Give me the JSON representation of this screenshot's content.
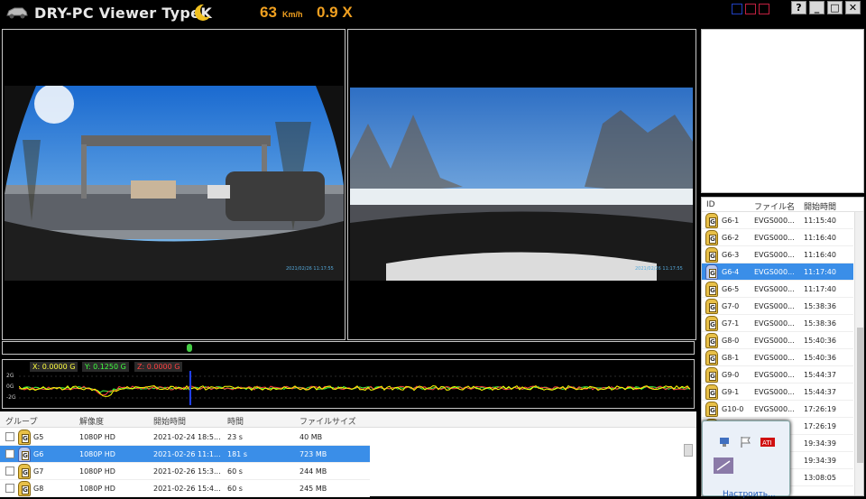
{
  "app": {
    "title": "DRY-PC Viewer TypeK",
    "speed_value": "63",
    "speed_unit": "Km/h",
    "gforce_value": "0.9 X"
  },
  "window_buttons": [
    "?",
    "_",
    "□",
    "✕"
  ],
  "cameras": {
    "front_timestamp": "2021/02/26 11:17:55",
    "rear_timestamp": "2021/02/26 11:17:55"
  },
  "graph": {
    "x_label": "X: 0.0000 G",
    "y_label": "Y: 0.1250 G",
    "z_label": "Z: 0.0000 G",
    "ticks": [
      "2G",
      "0G",
      "-2G"
    ],
    "colors": {
      "x": "#ffff00",
      "y": "#40ff40",
      "z": "#ff4040"
    }
  },
  "file_list": {
    "headers": {
      "id": "ID",
      "file": "ファイル名",
      "start": "開始時間"
    },
    "rows": [
      {
        "id": "G6-1",
        "file": "EVGS000...",
        "start": "11:15:40",
        "selected": false
      },
      {
        "id": "G6-2",
        "file": "EVGS000...",
        "start": "11:16:40",
        "selected": false
      },
      {
        "id": "G6-3",
        "file": "EVGS000...",
        "start": "11:16:40",
        "selected": false
      },
      {
        "id": "G6-4",
        "file": "EVGS000...",
        "start": "11:17:40",
        "selected": true
      },
      {
        "id": "G6-5",
        "file": "EVGS000...",
        "start": "11:17:40",
        "selected": false
      },
      {
        "id": "G7-0",
        "file": "EVGS000...",
        "start": "15:38:36",
        "selected": false
      },
      {
        "id": "G7-1",
        "file": "EVGS000...",
        "start": "15:38:36",
        "selected": false
      },
      {
        "id": "G8-0",
        "file": "EVGS000...",
        "start": "15:40:36",
        "selected": false
      },
      {
        "id": "G8-1",
        "file": "EVGS000...",
        "start": "15:40:36",
        "selected": false
      },
      {
        "id": "G9-0",
        "file": "EVGS000...",
        "start": "15:44:37",
        "selected": false
      },
      {
        "id": "G9-1",
        "file": "EVGS000...",
        "start": "15:44:37",
        "selected": false
      },
      {
        "id": "G10-0",
        "file": "EVGS000...",
        "start": "17:26:19",
        "selected": false
      },
      {
        "id": "",
        "file": "",
        "start": "17:26:19",
        "selected": false
      },
      {
        "id": "",
        "file": "",
        "start": "19:34:39",
        "selected": false
      },
      {
        "id": "",
        "file": "",
        "start": "19:34:39",
        "selected": false
      },
      {
        "id": "",
        "file": "",
        "start": "13:08:05",
        "selected": false
      }
    ]
  },
  "group_list": {
    "headers": {
      "group": "グループ",
      "resolution": "解像度",
      "start": "開始時間",
      "duration": "時間",
      "size": "ファイルサイズ"
    },
    "rows": [
      {
        "group": "G5",
        "resolution": "1080P HD",
        "start": "2021-02-24 18:5...",
        "duration": "23 s",
        "size": "40 MB",
        "selected": false
      },
      {
        "group": "G6",
        "resolution": "1080P HD",
        "start": "2021-02-26 11:1...",
        "duration": "181 s",
        "size": "723 MB",
        "selected": true
      },
      {
        "group": "G7",
        "resolution": "1080P HD",
        "start": "2021-02-26 15:3...",
        "duration": "60 s",
        "size": "244 MB",
        "selected": false
      },
      {
        "group": "G8",
        "resolution": "1080P HD",
        "start": "2021-02-26 15:4...",
        "duration": "60 s",
        "size": "245 MB",
        "selected": false
      }
    ]
  },
  "tray": {
    "link": "Настроить...",
    "icons": [
      "network-icon",
      "flag-icon",
      "ati-icon",
      "pen-icon"
    ]
  }
}
